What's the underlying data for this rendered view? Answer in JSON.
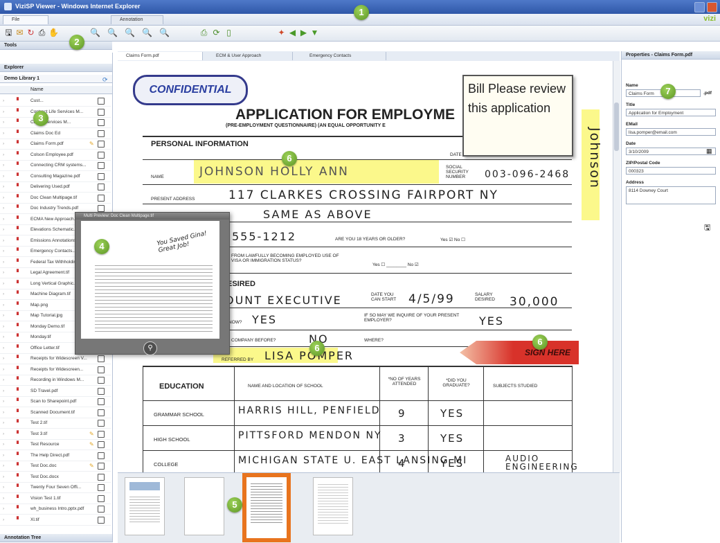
{
  "window": {
    "title": "ViziSP Viewer - Windows Internet Explorer"
  },
  "menu_tabs": [
    "File",
    "Annotation"
  ],
  "brand": "vizi",
  "left_panel": {
    "header": "Tools",
    "explorer_label": "Explorer",
    "library_label": "Demo Library 1",
    "column_header": "Name",
    "footer": "Annotation Tree",
    "files": [
      {
        "name": "Cust...",
        "ann": false
      },
      {
        "name": "Contract Life Services M...",
        "ann": false
      },
      {
        "name": "Clarke Services M...",
        "ann": false
      },
      {
        "name": "Claims Doc Ed",
        "ann": false
      },
      {
        "name": "Claims Form.pdf",
        "ann": true
      },
      {
        "name": "Colson Employee.pdf",
        "ann": false
      },
      {
        "name": "Connecting CRM systems...",
        "ann": false
      },
      {
        "name": "Consulting Magazine.pdf",
        "ann": false
      },
      {
        "name": "Delivering Used.pdf",
        "ann": false
      },
      {
        "name": "Doc Clean Multipage.tif",
        "ann": false
      },
      {
        "name": "Doc Industry Trends.pdf",
        "ann": false
      },
      {
        "name": "ECMA New Approach...",
        "ann": false
      },
      {
        "name": "Elevations Schematic...",
        "ann": false
      },
      {
        "name": "Emissions Annotations.tif",
        "ann": false
      },
      {
        "name": "Emergency Contacts...",
        "ann": false
      },
      {
        "name": "Federal Tax Withholding...",
        "ann": false
      },
      {
        "name": "Legal Agreement.tif",
        "ann": false
      },
      {
        "name": "Long Vertical Graphic...",
        "ann": false
      },
      {
        "name": "Machine Diagram.tif",
        "ann": false
      },
      {
        "name": "Map.png",
        "ann": false
      },
      {
        "name": "Map Tutorial.jpg",
        "ann": false
      },
      {
        "name": "Monday Demo.tif",
        "ann": false
      },
      {
        "name": "Monday.tif",
        "ann": false
      },
      {
        "name": "Office Letter.tif",
        "ann": false
      },
      {
        "name": "Receipts for Widescreen V...",
        "ann": false
      },
      {
        "name": "Receipts for Widescreen...",
        "ann": false
      },
      {
        "name": "Recording in Windows M...",
        "ann": false
      },
      {
        "name": "SD Travel.pdf",
        "ann": false
      },
      {
        "name": "Scan to Sharepoint.pdf",
        "ann": false
      },
      {
        "name": "Scanned Document.tif",
        "ann": false
      },
      {
        "name": "Test 2.tif",
        "ann": false
      },
      {
        "name": "Test 3.tif",
        "ann": true
      },
      {
        "name": "Test Resource",
        "ann": true
      },
      {
        "name": "The Help Direct.pdf",
        "ann": false
      },
      {
        "name": "Test Doc.doc",
        "ann": true
      },
      {
        "name": "Test Doc.docx",
        "ann": false
      },
      {
        "name": "Twenty Four Seven Offi...",
        "ann": false
      },
      {
        "name": "Vision Test 1.tif",
        "ann": false
      },
      {
        "name": "wh_business Intro.pptx.pdf",
        "ann": false
      },
      {
        "name": "Xl.tif",
        "ann": false
      }
    ]
  },
  "doc_tabs": [
    "Claims Form.pdf",
    "ECM & User Approach",
    "Emergency Contacts"
  ],
  "form": {
    "confidential": "CONFIDENTIAL",
    "title": "APPLICATION FOR EMPLOYME",
    "subtitle": "(PRE-EMPLOYMENT QUESTIONNAIRE)  (AN EQUAL OPPORTUNITY E",
    "personal_info": "PERSONAL INFORMATION",
    "date_label": "DATE",
    "name_label": "NAME",
    "name_value": "JOHNSON   HOLLY   ANN",
    "ssn_label": "SOCIAL SECURITY NUMBER",
    "ssn_value": "003-096-2468",
    "present_address_label": "PRESENT ADDRESS",
    "present_address_value": "117  CLARKES  CROSSING  FAIRPORT NY",
    "permanent_address_value": "SAME  AS  ABOVE",
    "phone_value": "555-1212",
    "age_q": "ARE YOU 18 YEARS OR OLDER?",
    "yes_no": "Yes ☑  No ☐",
    "visa_q": "FROM LAWFULLY BECOMING EMPLOYED USE OF VISA OR IMMIGRATION STATUS?",
    "visa_ans": "Yes ☐ ________  No ☑",
    "desired": "ESIRED",
    "position_value": "OUNT  EXECUTIVE",
    "date_start_label": "DATE YOU CAN START",
    "date_start_value": "4/5/99",
    "salary_label": "SALARY DESIRED",
    "salary_value": "30,000",
    "employed_now_label": "NOW?",
    "employed_now_value": "YES",
    "inquire_label": "IF SO MAY WE INQUIRE OF YOUR PRESENT EMPLOYER?",
    "inquire_value": "YES",
    "company_before": "COMPANY BEFORE?",
    "company_before_value": "NO",
    "where": "WHERE?",
    "referred_label": "REFERRED BY",
    "referred_value": "LISA  POMPER",
    "education_header": "EDUCATION",
    "edu_cols": [
      "NAME AND LOCATION OF SCHOOL",
      "*NO OF YEARS ATTENDED",
      "*DID YOU GRADUATE?",
      "SUBJECTS STUDIED"
    ],
    "edu_rows": [
      {
        "level": "GRAMMAR SCHOOL",
        "school": "HARRIS HILL, PENFIELD",
        "years": "9",
        "grad": "YES",
        "subjects": ""
      },
      {
        "level": "HIGH SCHOOL",
        "school": "PITTSFORD MENDON NY",
        "years": "3",
        "grad": "YES",
        "subjects": ""
      },
      {
        "level": "COLLEGE",
        "school": "MICHIGAN STATE U. EAST LANSING MI",
        "years": "4",
        "grad": "YES",
        "subjects": "AUDIO ENGINEERING"
      }
    ],
    "sticky_note": "Bill Please review this application",
    "sign_here": "SIGN HERE",
    "margin_sig": "Johnson"
  },
  "popup": {
    "title": "Multi Preview: Doc Clean Multipage.tif",
    "note": "You Saved Gina! Great Job!"
  },
  "properties": {
    "header": "Properties - Claims Form.pdf",
    "fields": [
      {
        "label": "Name",
        "value": "Claims Form"
      },
      {
        "label": "Title",
        "value": "Application for Employment"
      },
      {
        "label": "EMail",
        "value": "lisa.pomper@email.com"
      },
      {
        "label": "Date",
        "value": "3/10/2009"
      },
      {
        "label": "ZIP/Postal Code",
        "value": "000323"
      },
      {
        "label": "Address",
        "value": "8114 Downey Court"
      }
    ],
    "name_ext": ".pdf"
  },
  "markers": [
    "1",
    "2",
    "3",
    "4",
    "5",
    "6",
    "6",
    "6",
    "7"
  ],
  "colors": {
    "accent": "#2f57a8",
    "marker": "#6aa42c",
    "highlight": "#f7f15a",
    "thumb_selected": "#e8741e",
    "sign_here": "#d8322a"
  }
}
